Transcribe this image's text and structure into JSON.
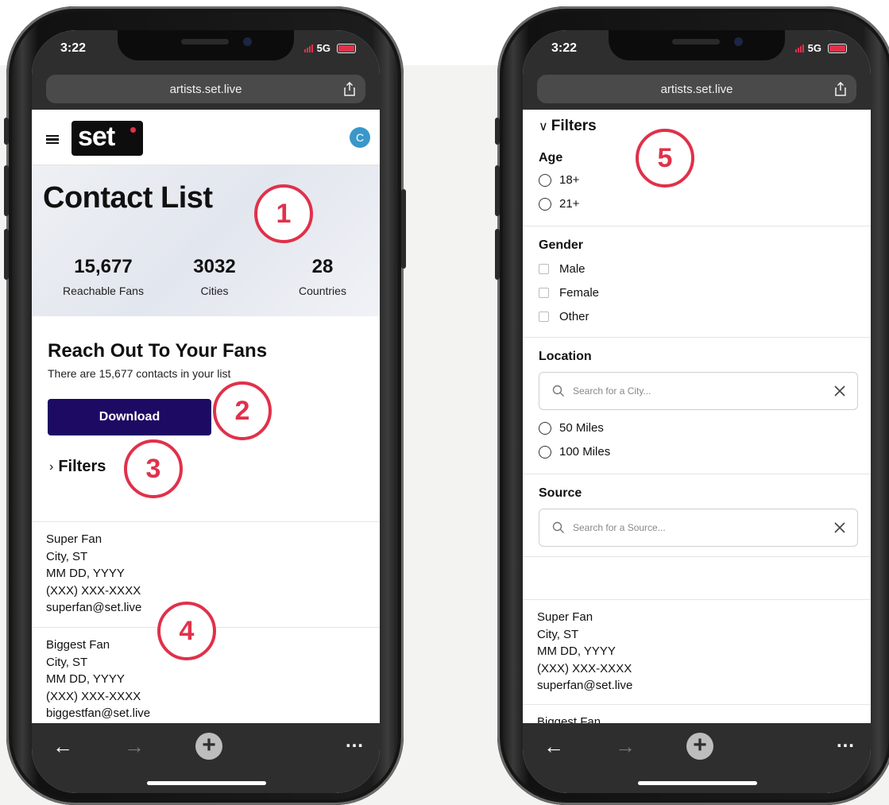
{
  "colors": {
    "accent_red": "#e0314b",
    "download_button": "#1d0a63",
    "avatar": "#3a97c9",
    "browser_chrome": "#2e2e2e"
  },
  "annotations": [
    "1",
    "2",
    "3",
    "4",
    "5"
  ],
  "phones": [
    {
      "status": {
        "time": "3:22",
        "network": "5G"
      },
      "url": "artists.set.live",
      "header": {
        "logo": "set",
        "avatar_initial": "C"
      },
      "hero": {
        "title": "Contact List",
        "stats": [
          {
            "value": "15,677",
            "label": "Reachable Fans"
          },
          {
            "value": "3032",
            "label": "Cities"
          },
          {
            "value": "28",
            "label": "Countries"
          }
        ]
      },
      "reach": {
        "title": "Reach Out To Your Fans",
        "subtitle": "There are 15,677 contacts in your list",
        "download_label": "Download",
        "filters_label": "Filters"
      },
      "contacts": [
        {
          "name": "Super Fan",
          "location": "City, ST",
          "date": "MM DD, YYYY",
          "phone": "(XXX) XXX-XXXX",
          "email": "superfan@set.live"
        },
        {
          "name": "Biggest Fan",
          "location": "City, ST",
          "date": "MM DD, YYYY",
          "phone": "(XXX) XXX-XXXX",
          "email": "biggestfan@set.live"
        }
      ]
    },
    {
      "status": {
        "time": "3:22",
        "network": "5G"
      },
      "url": "artists.set.live",
      "filters": {
        "title": "Filters",
        "age": {
          "label": "Age",
          "options": [
            "18+",
            "21+"
          ]
        },
        "gender": {
          "label": "Gender",
          "options": [
            "Male",
            "Female",
            "Other"
          ]
        },
        "location": {
          "label": "Location",
          "placeholder": "Search for a City...",
          "options": [
            "50 Miles",
            "100 Miles"
          ]
        },
        "source": {
          "label": "Source",
          "placeholder": "Search for a Source..."
        }
      },
      "contacts": [
        {
          "name": "Super Fan",
          "location": "City, ST",
          "date": "MM DD, YYYY",
          "phone": "(XXX) XXX-XXXX",
          "email": "superfan@set.live"
        },
        {
          "name": "Biggest Fan"
        }
      ]
    }
  ]
}
